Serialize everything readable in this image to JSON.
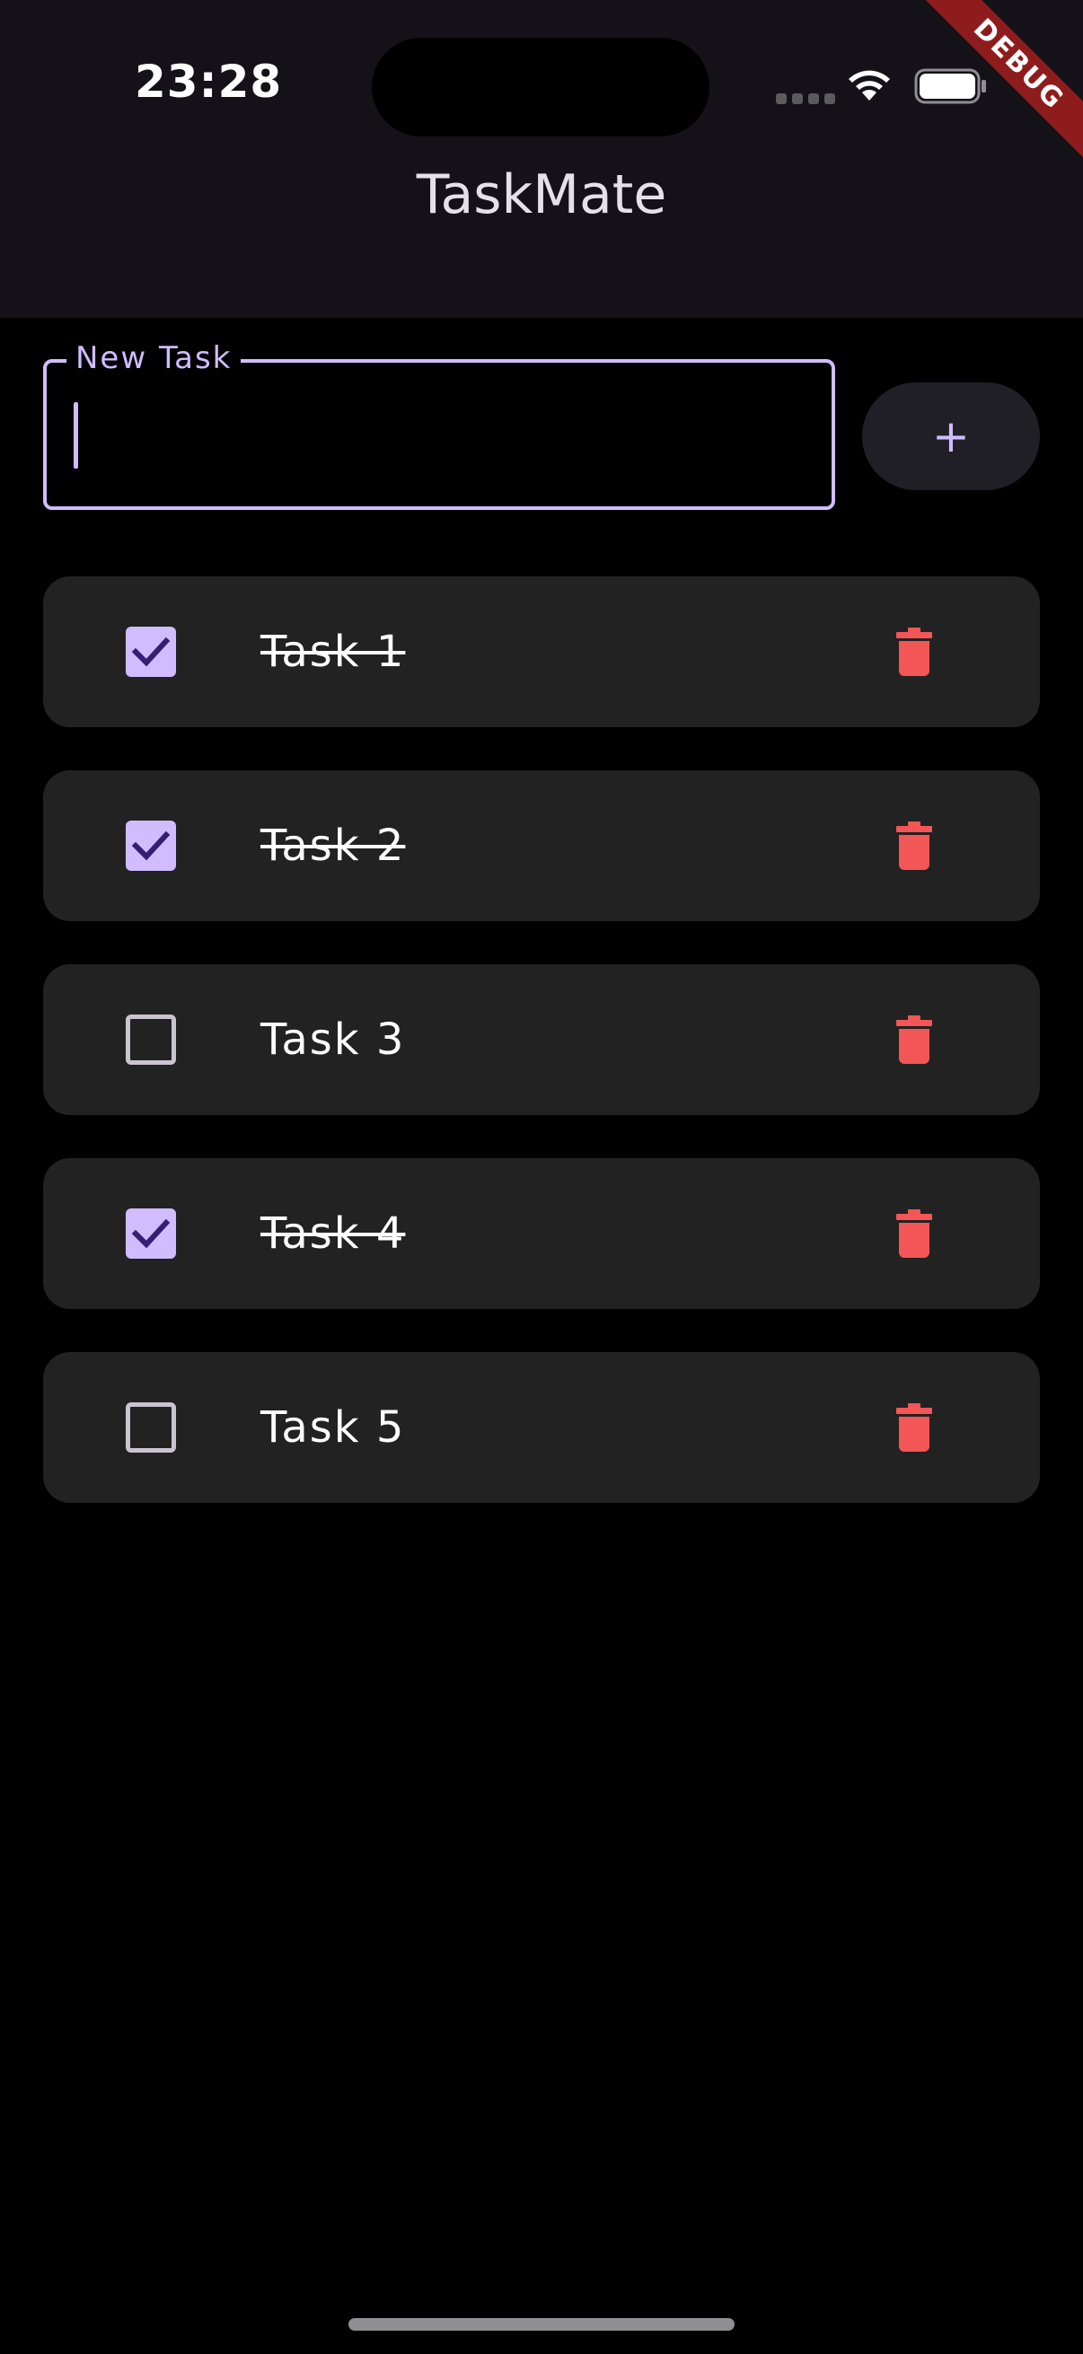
{
  "status_bar": {
    "time": "23:28"
  },
  "debug_banner": {
    "label": "DEBUG"
  },
  "app_bar": {
    "title": "TaskMate"
  },
  "new_task": {
    "label": "New Task",
    "value": "",
    "add_button_label": "+"
  },
  "tasks": [
    {
      "label": "Task 1",
      "completed": true
    },
    {
      "label": "Task 2",
      "completed": true
    },
    {
      "label": "Task 3",
      "completed": false
    },
    {
      "label": "Task 4",
      "completed": true
    },
    {
      "label": "Task 5",
      "completed": false
    }
  ],
  "icons": {
    "checkbox_checked": "check-icon",
    "delete": "trash-icon",
    "wifi": "wifi-icon",
    "battery": "battery-icon"
  },
  "colors": {
    "accent": "#d0bcff",
    "delete": "#f25656",
    "card": "#222222",
    "app_bar": "#141218",
    "debug": "#8f1c1c"
  }
}
